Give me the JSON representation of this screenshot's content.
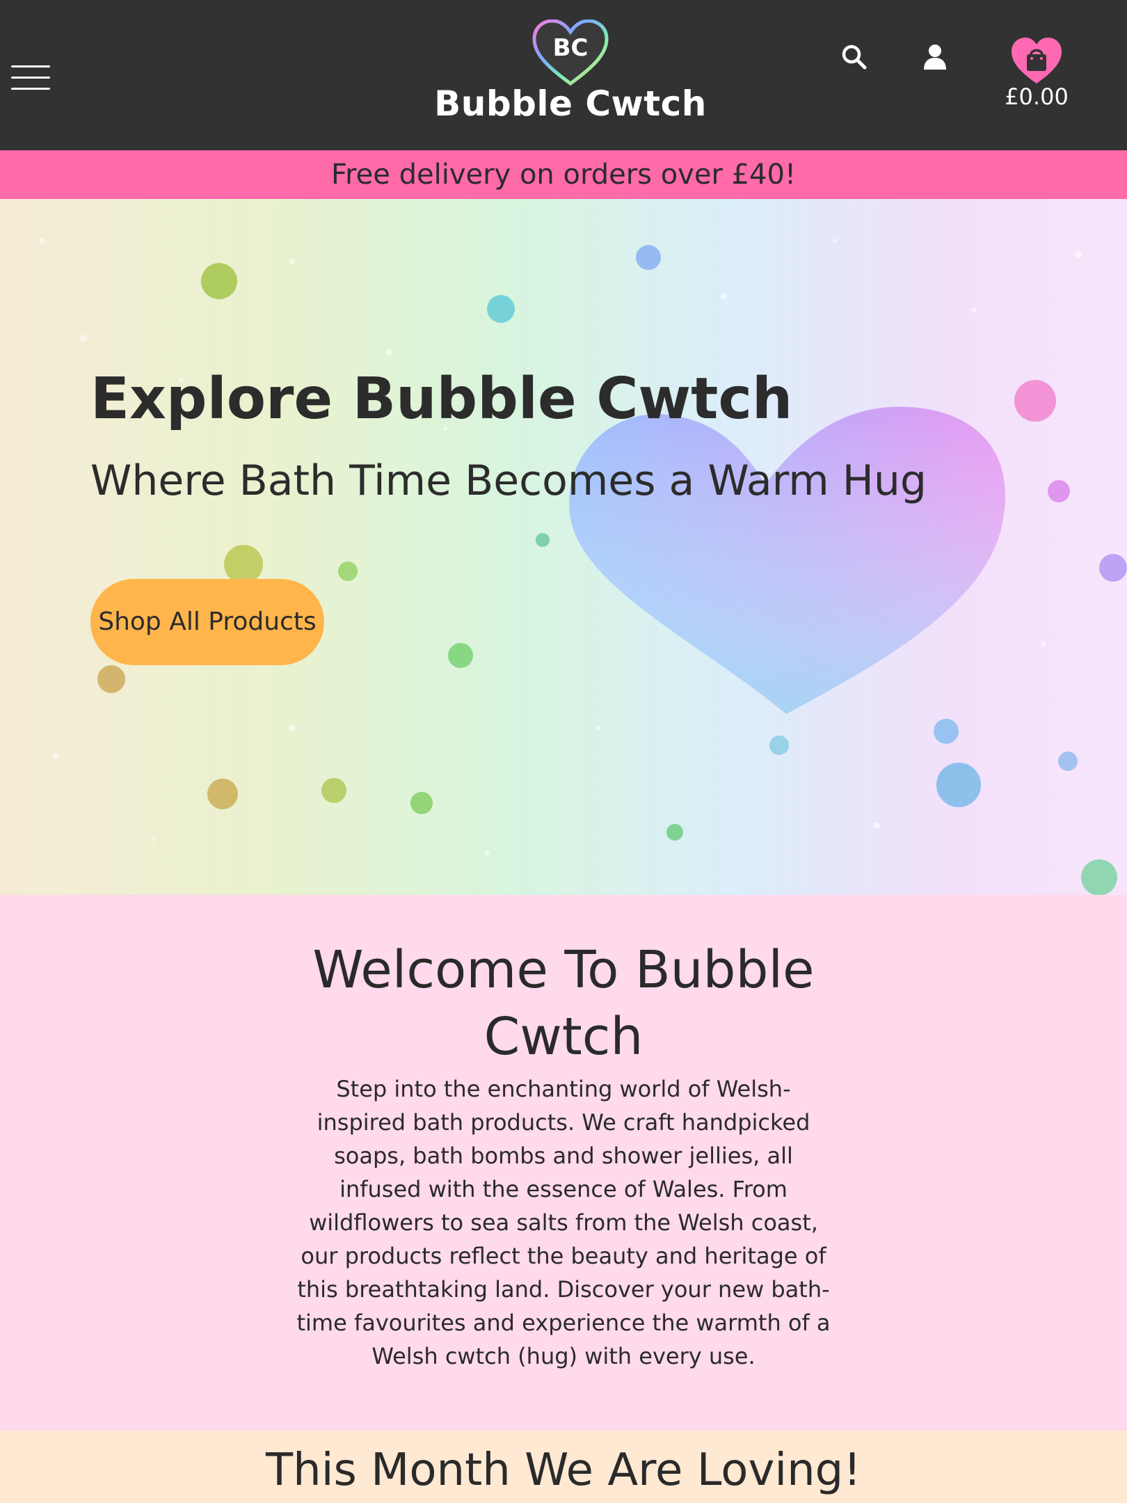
{
  "header": {
    "logo_initials": "BC",
    "logo_text": "Bubble Cwtch",
    "cart_total": "£0.00",
    "icons": [
      "menu-icon",
      "search-icon",
      "account-icon",
      "cart-icon"
    ]
  },
  "promo": {
    "text": "Free delivery on orders over £40!"
  },
  "hero": {
    "title": "Explore Bubble Cwtch",
    "subtitle": "Where Bath Time Becomes a Warm Hug",
    "button_label": "Shop All Products"
  },
  "welcome": {
    "title": "Welcome To Bubble Cwtch",
    "text": "Step into the enchanting world of Welsh-inspired bath products. We craft handpicked soaps, bath bombs and shower jellies, all infused with the essence of Wales. From wildflowers to sea salts from the Welsh coast, our products reflect the beauty and heritage of this breathtaking land. Discover your new bath-time favourites and experience the warmth of a Welsh cwtch (hug) with every use."
  },
  "loving": {
    "title": "This Month We Are Loving!"
  },
  "colors": {
    "header_bg": "#333232",
    "promo_bg": "#ff6aa9",
    "button_bg": "#ffb54b",
    "welcome_bg": "#ffd9ec",
    "loving_bg": "#ffe9d3",
    "cart_heart": "#ff69b4"
  }
}
